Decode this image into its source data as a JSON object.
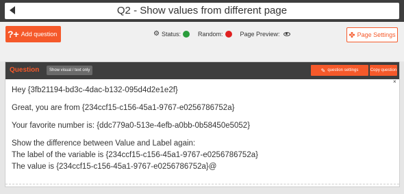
{
  "header": {
    "title": "Q2 -  Show values from different page"
  },
  "toolbar": {
    "add_question_label": "Add question",
    "status_label": "Status:",
    "status_color": "#2a9d3c",
    "random_label": "Random:",
    "random_color": "#e02020",
    "preview_label": "Page Preview:",
    "page_settings_label": "Page Settings"
  },
  "question": {
    "header_label": "Question",
    "toggle_label": "Show visual / text only",
    "settings_label": "question settings",
    "copy_label": "Copy question",
    "close_label": "×",
    "lines": [
      "Hey {3fb21194-bd3c-4dac-b132-095d4d2e1e2f}",
      "Great, you are from {234ccf15-c156-45a1-9767-e0256786752a}",
      "Your favorite number is:  {ddc779a0-513e-4efb-a0bb-0b58450e5052}",
      "Show the difference between Value and Label again:",
      "The label of the variable is {234ccf15-c156-45a1-9767-e0256786752a}",
      "The value is {234ccf15-c156-45a1-9767-e0256786752a}@"
    ]
  },
  "colors": {
    "accent": "#f5592a",
    "dark_bar": "#3e3e3e"
  }
}
